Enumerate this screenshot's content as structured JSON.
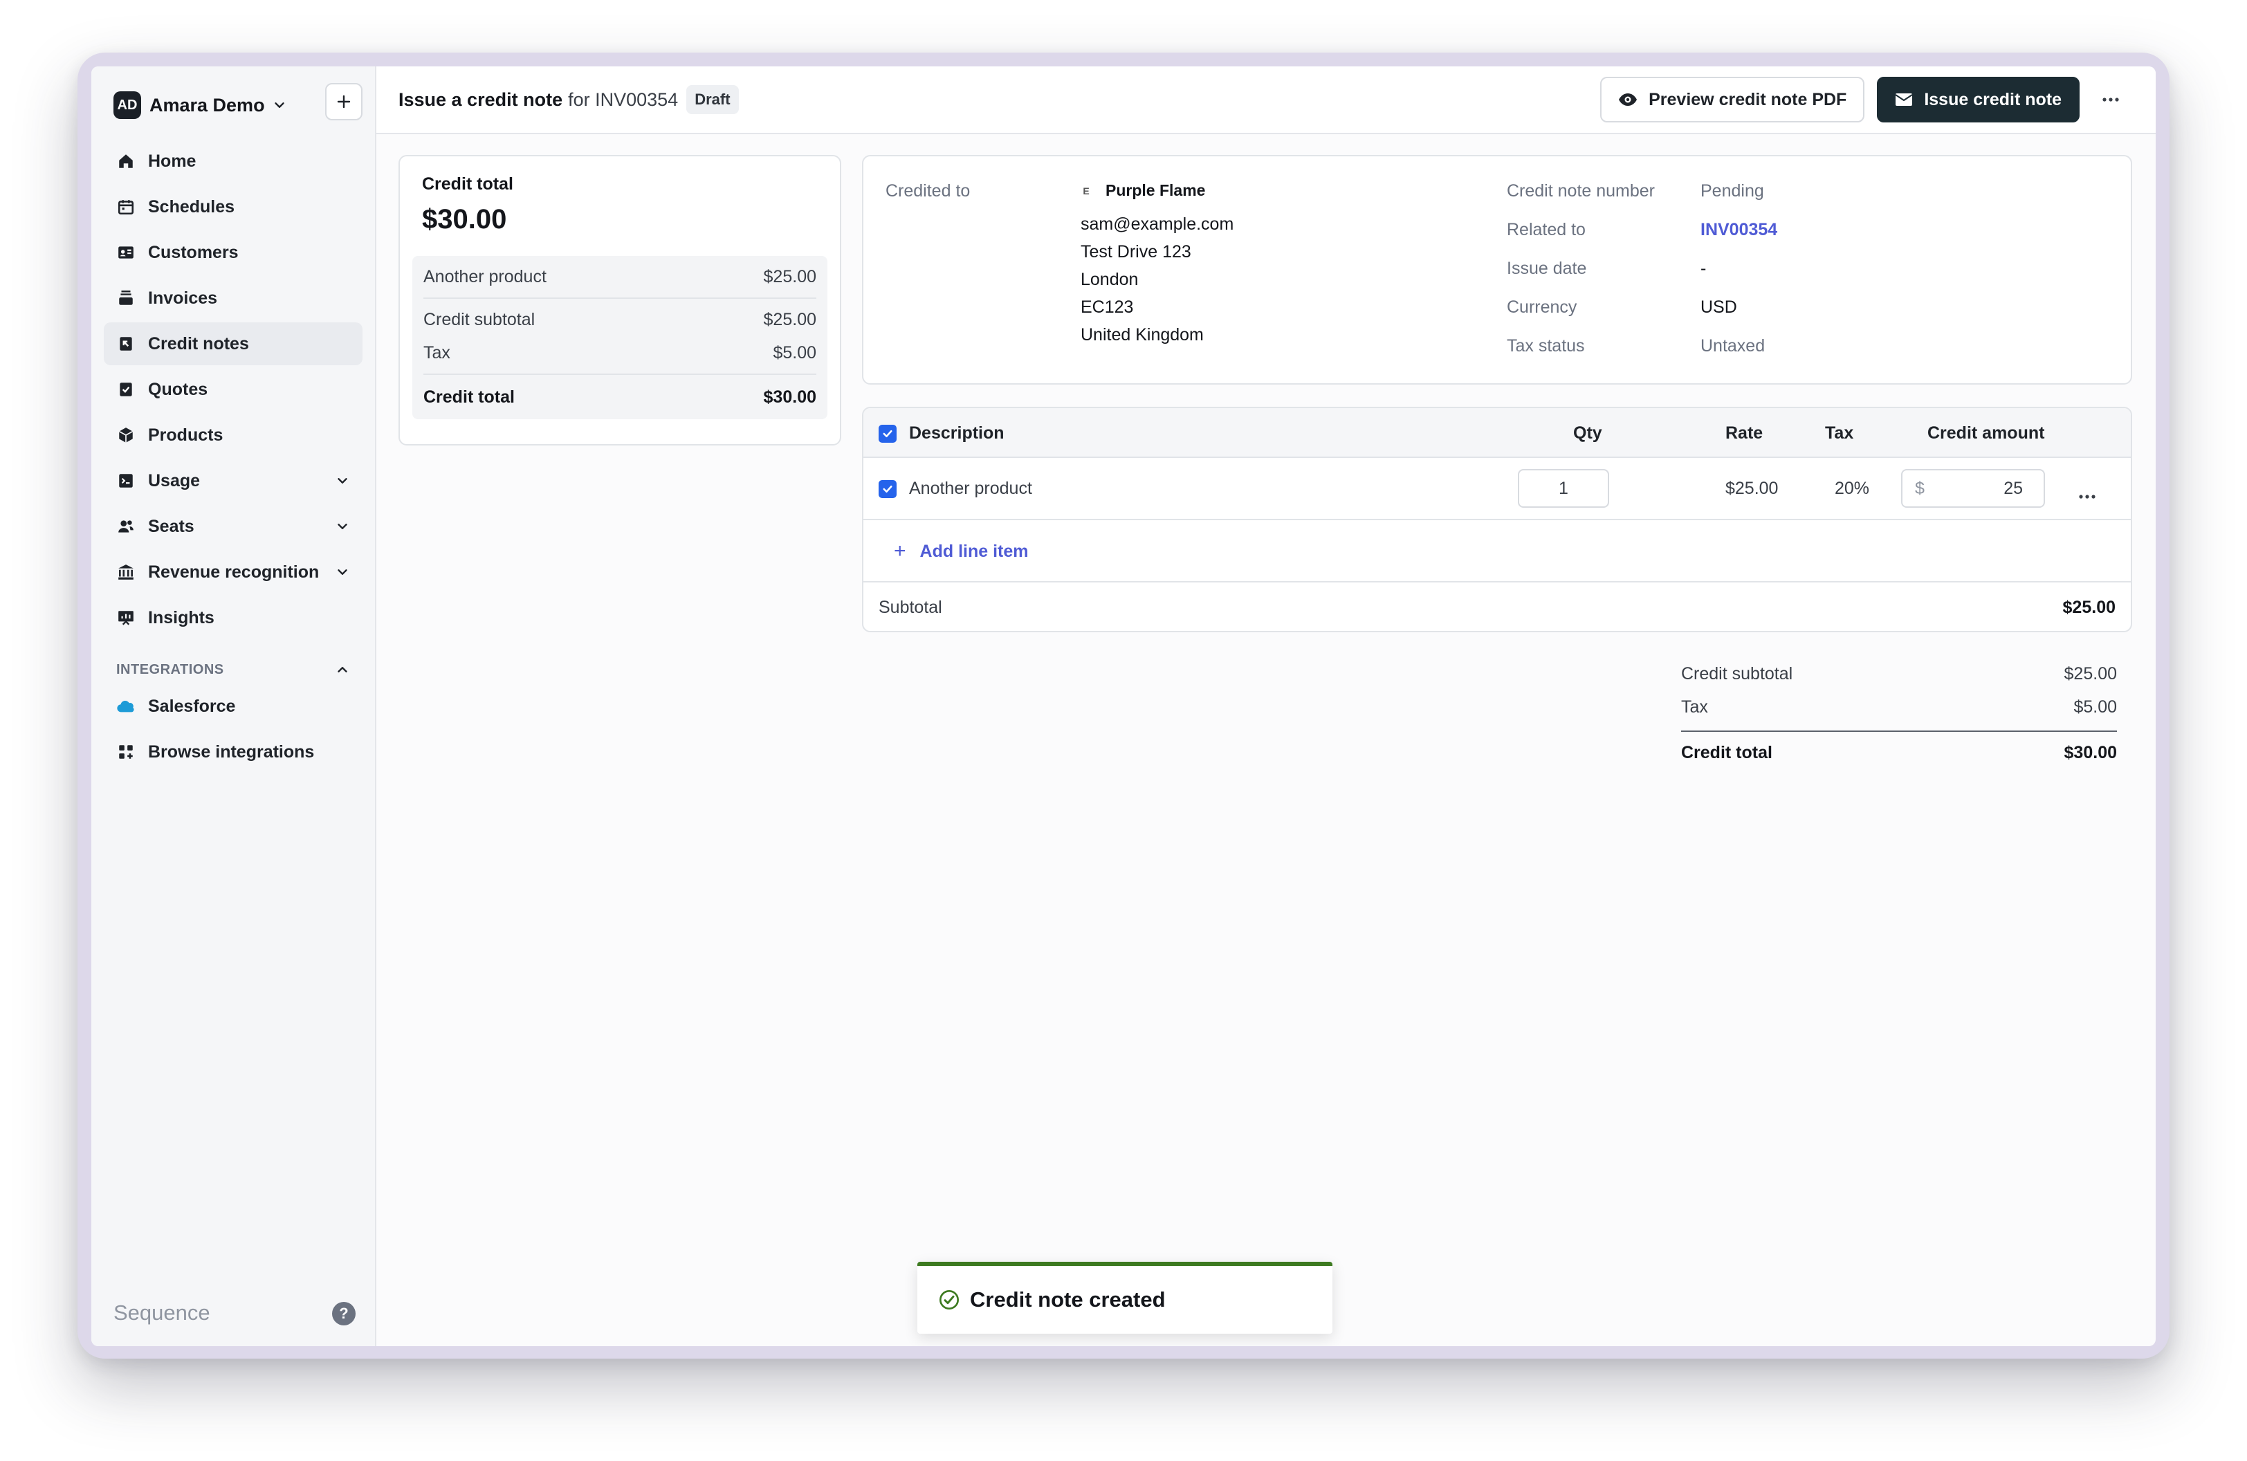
{
  "org": {
    "avatar": "AD",
    "name": "Amara Demo"
  },
  "sidebar": {
    "items": [
      {
        "label": "Home",
        "icon": "home-icon"
      },
      {
        "label": "Schedules",
        "icon": "calendar-icon"
      },
      {
        "label": "Customers",
        "icon": "contact-card-icon"
      },
      {
        "label": "Invoices",
        "icon": "invoice-stack-icon"
      },
      {
        "label": "Credit notes",
        "icon": "credit-note-icon",
        "active": true
      },
      {
        "label": "Quotes",
        "icon": "quote-check-icon"
      },
      {
        "label": "Products",
        "icon": "cube-icon"
      },
      {
        "label": "Usage",
        "icon": "terminal-icon",
        "expandable": true
      },
      {
        "label": "Seats",
        "icon": "users-icon",
        "expandable": true
      },
      {
        "label": "Revenue recognition",
        "icon": "bank-icon",
        "expandable": true
      },
      {
        "label": "Insights",
        "icon": "chart-board-icon"
      }
    ],
    "integrations_label": "INTEGRATIONS",
    "integrations": [
      {
        "label": "Salesforce",
        "icon": "salesforce-cloud-icon"
      },
      {
        "label": "Browse integrations",
        "icon": "grid-plus-icon"
      }
    ],
    "brand": "Sequence",
    "help": "?"
  },
  "header": {
    "title_strong": "Issue a credit note",
    "title_rest": "for INV00354",
    "status": "Draft",
    "preview_label": "Preview credit note PDF",
    "issue_label": "Issue credit note"
  },
  "total_card": {
    "label": "Credit total",
    "amount": "$30.00",
    "rows": [
      {
        "label": "Another product",
        "value": "$25.00"
      }
    ],
    "subtotal_label": "Credit subtotal",
    "subtotal_value": "$25.00",
    "tax_label": "Tax",
    "tax_value": "$5.00",
    "total_label": "Credit total",
    "total_value": "$30.00"
  },
  "details": {
    "credited_to_label": "Credited to",
    "customer_initial": "E",
    "customer_name": "Purple Flame",
    "address": [
      "sam@example.com",
      "Test Drive 123",
      "London",
      "EC123",
      "United Kingdom"
    ],
    "fields": [
      {
        "label": "Credit note number",
        "value": "Pending"
      },
      {
        "label": "Related to",
        "value": "INV00354"
      },
      {
        "label": "Issue date",
        "value": "-"
      },
      {
        "label": "Currency",
        "value": "USD"
      },
      {
        "label": "Tax status",
        "value": "Untaxed"
      }
    ]
  },
  "items": {
    "headers": {
      "description": "Description",
      "qty": "Qty",
      "rate": "Rate",
      "tax": "Tax",
      "amount": "Credit amount"
    },
    "rows": [
      {
        "description": "Another product",
        "qty": "1",
        "rate": "$25.00",
        "tax": "20%",
        "currency": "$",
        "amount": "25"
      }
    ],
    "add_label": "Add line item",
    "subtotal_label": "Subtotal",
    "subtotal_value": "$25.00"
  },
  "summary": {
    "subtotal_label": "Credit subtotal",
    "subtotal_value": "$25.00",
    "tax_label": "Tax",
    "tax_value": "$5.00",
    "total_label": "Credit total",
    "total_value": "$30.00"
  },
  "toast": {
    "message": "Credit note created",
    "accent": "#3d7a20"
  },
  "colors": {
    "accent_dark": "#1c2c33",
    "link": "#4f5bd5",
    "checkbox": "#2563eb"
  }
}
